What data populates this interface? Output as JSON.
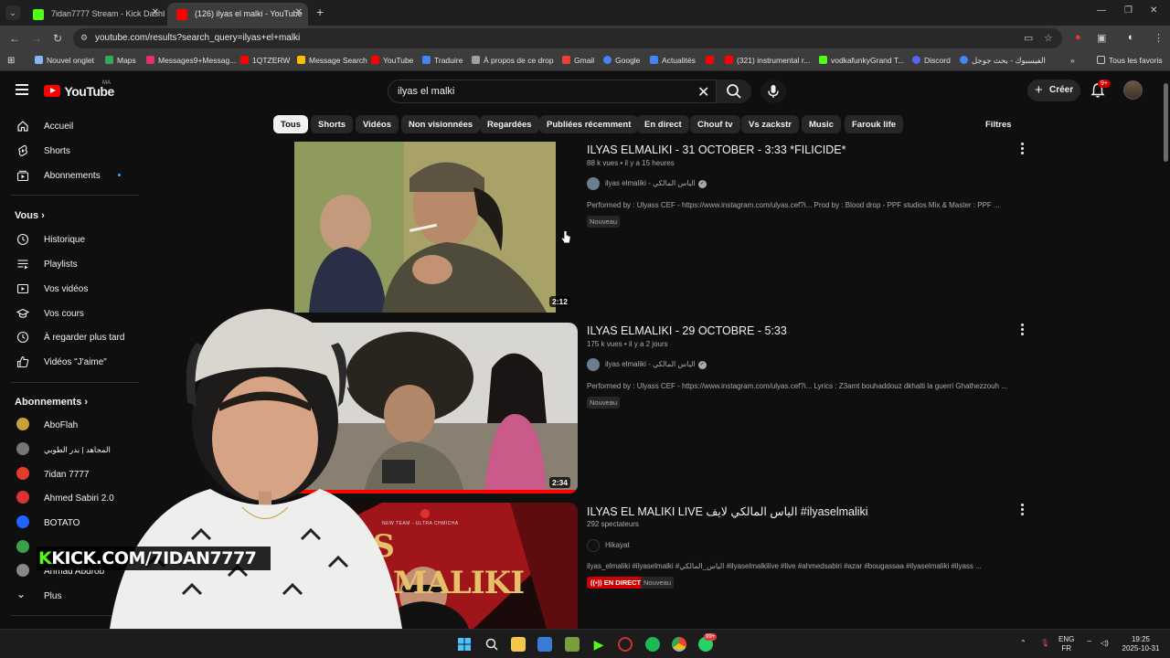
{
  "browser": {
    "tabs": [
      {
        "title": "7idan7777 Stream - Kick Dashb",
        "active": false,
        "favicon_color": "#53fc18"
      },
      {
        "title": "(126) ilyas el malki - YouTube",
        "active": true,
        "favicon_color": "#ff0000"
      }
    ],
    "url": "youtube.com/results?search_query=ilyas+el+malki",
    "bookmarks": [
      {
        "label": "Nouvel onglet",
        "icon_color": "#8ab4f8"
      },
      {
        "label": "Maps",
        "icon_color": "#34a853"
      },
      {
        "label": "Messages9+Messag...",
        "icon_color": "#e1306c"
      },
      {
        "label": "1QTZERW",
        "icon_color": "#ff0000"
      },
      {
        "label": "Message Search",
        "icon_color": "#fbbc04"
      },
      {
        "label": "YouTube",
        "icon_color": "#ff0000"
      },
      {
        "label": "Traduire",
        "icon_color": "#4285f4"
      },
      {
        "label": "À propos de ce drop",
        "icon_color": "#9aa0a6"
      },
      {
        "label": "Gmail",
        "icon_color": "#ea4335"
      },
      {
        "label": "Google",
        "icon_color": "#4285f4"
      },
      {
        "label": "Actualités",
        "icon_color": "#4285f4"
      },
      {
        "label": "",
        "icon_color": "#ff0000"
      },
      {
        "label": "(321) instrumental r...",
        "icon_color": "#ff0000"
      },
      {
        "label": "vodkafunkyGrand T...",
        "icon_color": "#53fc18"
      },
      {
        "label": "Discord",
        "icon_color": "#5865f2"
      },
      {
        "label": "الفيسبوك - بحث جوجل",
        "icon_color": "#4285f4"
      }
    ],
    "all_bookmarks": "Tous les favoris"
  },
  "youtube": {
    "logo_text": "YouTube",
    "region": "MA",
    "search_query": "ilyas el malki",
    "create_label": "Créer",
    "notifications": "9+"
  },
  "sidebar": {
    "main": [
      {
        "label": "Accueil",
        "icon": "home-icon"
      },
      {
        "label": "Shorts",
        "icon": "shorts-icon"
      },
      {
        "label": "Abonnements",
        "icon": "subscriptions-icon"
      }
    ],
    "you_heading": "Vous",
    "you": [
      {
        "label": "Historique",
        "icon": "history-icon"
      },
      {
        "label": "Playlists",
        "icon": "playlists-icon"
      },
      {
        "label": "Vos vidéos",
        "icon": "your-videos-icon"
      },
      {
        "label": "Vos cours",
        "icon": "courses-icon"
      },
      {
        "label": "À regarder plus tard",
        "icon": "watch-later-icon"
      },
      {
        "label": "Vidéos \"J'aime\"",
        "icon": "liked-icon"
      }
    ],
    "subs_heading": "Abonnements",
    "subscriptions": [
      {
        "label": "AboFlah",
        "color": "#c9a13b"
      },
      {
        "label": "المجاهد | بدر الطوبي",
        "color": "#777777"
      },
      {
        "label": "7idan 7777",
        "color": "#e23c2c"
      },
      {
        "label": "Ahmed Sabiri 2.0",
        "color": "#d33"
      },
      {
        "label": "BOTATO",
        "color": "#1e66ff"
      },
      {
        "label": "",
        "color": "#3aa14a"
      },
      {
        "label": "Ahmad Abdrob",
        "color": "#888888"
      }
    ],
    "more_label": "Plus"
  },
  "chips": [
    "Tous",
    "Shorts",
    "Vidéos",
    "Non visionnées",
    "Regardées",
    "Publiées récemment",
    "En direct",
    "Chouf tv",
    "Vs zackstr",
    "Music",
    "Farouk life"
  ],
  "filters_label": "Filtres",
  "results": [
    {
      "title": "ILYAS ELMALIKI - 31 OCTOBER - 3:33 *FILICIDE*",
      "views": "88 k vues",
      "age": "il y a 15 heures",
      "channel": "ilyas elmaliki - الياس المالكي",
      "verified": true,
      "description": "Performed by : Ulyass CEF - https://www.instagram.com/ulyas.cef?i... Prod by : Blood drop - PPF studios Mix & Master : PPF ...",
      "badges": [
        "Nouveau"
      ],
      "duration": "2:12"
    },
    {
      "title": "ILYAS ELMALIKI - 29 OCTOBRE - 5:33",
      "views": "175 k vues",
      "age": "il y a 2 jours",
      "channel": "ilyas elmaliki - الياس المالكي",
      "verified": true,
      "description": "Performed by : Ulyass CEF - https://www.instagram.com/ulyas.cef?i... Lyrics : Z3amt bouhaddouz dkhalti la guerri Ghathezzouh ...",
      "badges": [
        "Nouveau"
      ],
      "duration": "2:34"
    },
    {
      "title": "ILYAS EL MALIKI LIVE الياس المالكي لايف #ilyaselmaliki",
      "views": "292 spectateurs",
      "age": "",
      "channel": "Hikayat",
      "verified": false,
      "description": "ilyas_elmaliki #ilyaselmalki #الياس_المالكي #ilyaselmalkilive #live #ahmedsabiri #azar #bougassaa #ilyaselmaliki #ilyass ...",
      "badges": [
        "EN DIRECT",
        "Nouveau"
      ],
      "thumb_text_top": "NEW TEAM - ULTRA CHMICHA",
      "thumb_text": "AS ELMALIKI"
    }
  ],
  "overlay": {
    "kick_prefix": "K",
    "kick_text": "KICK.COM/7IDAN7777"
  },
  "taskbar": {
    "lang_top": "ENG",
    "lang_bottom": "FR",
    "time": "19:25",
    "date": "2025-10-31",
    "whatsapp_badge": "99+"
  }
}
